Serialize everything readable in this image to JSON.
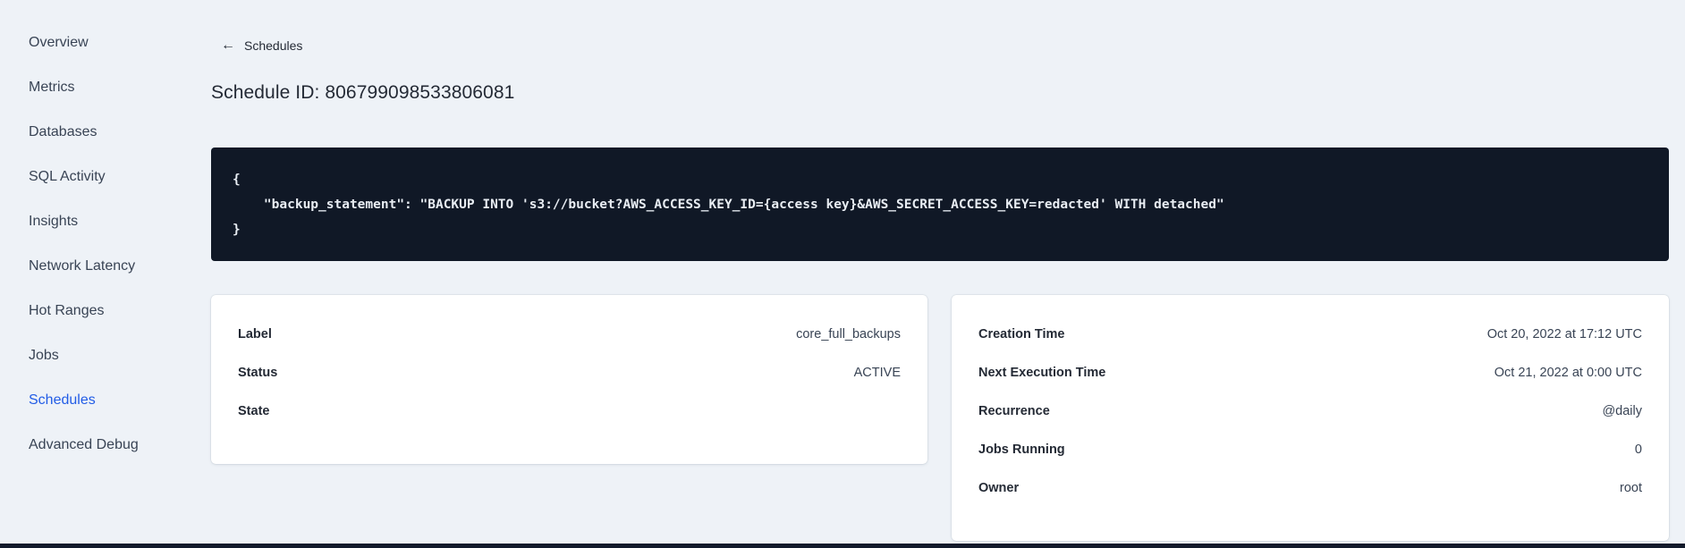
{
  "sidebar": {
    "items": [
      {
        "label": "Overview",
        "active": false
      },
      {
        "label": "Metrics",
        "active": false
      },
      {
        "label": "Databases",
        "active": false
      },
      {
        "label": "SQL Activity",
        "active": false
      },
      {
        "label": "Insights",
        "active": false
      },
      {
        "label": "Network Latency",
        "active": false
      },
      {
        "label": "Hot Ranges",
        "active": false
      },
      {
        "label": "Jobs",
        "active": false
      },
      {
        "label": "Schedules",
        "active": true
      },
      {
        "label": "Advanced Debug",
        "active": false
      }
    ]
  },
  "header": {
    "back_icon": "←",
    "back_link": "Schedules",
    "title": "Schedule ID: 806799098533806081"
  },
  "code_block": {
    "lines": [
      "{",
      "    \"backup_statement\": \"BACKUP INTO 's3://bucket?AWS_ACCESS_KEY_ID={access key}&AWS_SECRET_ACCESS_KEY=redacted' WITH detached\"",
      "}"
    ]
  },
  "details_card": {
    "rows": [
      {
        "label": "Label",
        "value": "core_full_backups"
      },
      {
        "label": "Status",
        "value": "ACTIVE"
      },
      {
        "label": "State",
        "value": ""
      }
    ]
  },
  "schedule_card": {
    "rows": [
      {
        "label": "Creation Time",
        "value": "Oct 20, 2022 at 17:12 UTC"
      },
      {
        "label": "Next Execution Time",
        "value": "Oct 21, 2022 at 0:00 UTC"
      },
      {
        "label": "Recurrence",
        "value": "@daily"
      },
      {
        "label": "Jobs Running",
        "value": "0"
      },
      {
        "label": "Owner",
        "value": "root"
      }
    ]
  },
  "colors": {
    "accent_blue": "#215ce6",
    "code_background": "#101826",
    "page_background": "#eef2f7",
    "text_dark": "#242a35",
    "text_body": "#394455"
  }
}
